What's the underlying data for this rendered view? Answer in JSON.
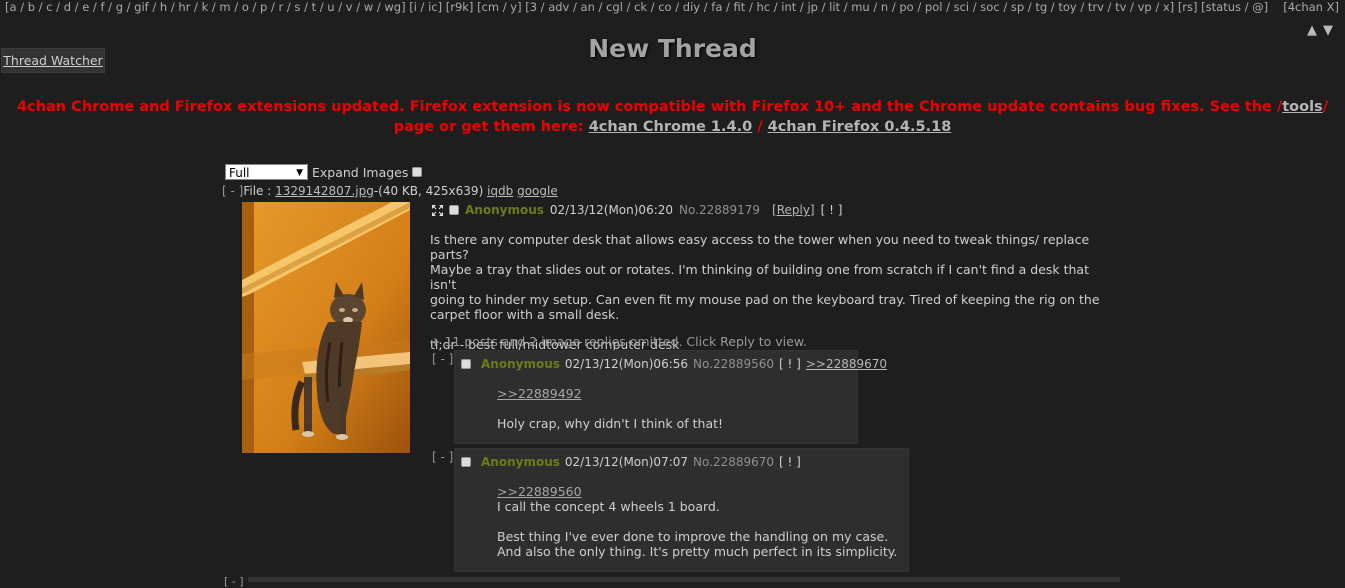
{
  "nav": {
    "boards_text": "[a / b / c / d / e / f / g / gif / h / hr / k / m / o / p / r / s / t / u / v / w / wg] [i / ic] [r9k] [cm / y] [3 / adv / an / cgl / ck / co / diy / fa / fit / hc / int / jp / lit / mu / n / po / pol / sci / soc / sp / tg / toy / trv / tv / vp / x] [rs] [status / @]",
    "extension_label": "[4chan X]",
    "arrow_up": "▲",
    "arrow_down": "▼"
  },
  "page_title": "New Thread",
  "thread_watcher_label": "Thread Watcher",
  "announcement": {
    "text_before": "4chan Chrome and Firefox extensions updated. Firefox extension is now compatible with Firefox 10+ and the Chrome update contains bug fixes. See the /",
    "tools_link": "tools",
    "text_mid": "/ page or get them here: ",
    "chrome_link": "4chan Chrome 1.4.0",
    "separator": " / ",
    "firefox_link": "4chan Firefox 0.4.5.18"
  },
  "controls": {
    "image_mode": "Full",
    "expand_images_label": "Expand Images"
  },
  "op": {
    "toggle": "[ - ]",
    "file_prefix": "File : ",
    "file_name": "1329142807.jpg",
    "file_info": "-(40 KB, 425x639) ",
    "iqdb_link": "iqdb",
    "google_link": "google",
    "name": "Anonymous",
    "date": "02/13/12(Mon)06:20",
    "post_no": "No.22889179",
    "reply_link": "[Reply]",
    "report": "[ ! ]",
    "body_lines": [
      "Is there any computer desk that allows easy access to the tower when you need to tweak things/ replace parts?",
      "Maybe a tray that slides out or rotates. I'm thinking of building one from scratch if I can't find a desk that isn't",
      "going to hinder my setup. Can even fit my mouse pad on the keyboard tray. Tired of keeping the rig on the",
      "carpet floor with a small desk.",
      "",
      "tl;dr - best full/midtower computer desk"
    ],
    "omitted": "+ 11 posts and 2 image replies omitted. Click Reply to view."
  },
  "replies": [
    {
      "toggle": "[ - ]",
      "name": "Anonymous",
      "date": "02/13/12(Mon)06:56",
      "post_no": "No.22889560",
      "report": "[ ! ]",
      "backlink": ">>22889670",
      "quote": ">>22889492",
      "lines": [
        "Holy crap, why didn't I think of that!"
      ]
    },
    {
      "toggle": "[ - ]",
      "name": "Anonymous",
      "date": "02/13/12(Mon)07:07",
      "post_no": "No.22889670",
      "report": "[ ! ]",
      "backlink": "",
      "quote": ">>22889560",
      "lines": [
        "I call the concept 4 wheels 1 board.",
        "",
        "Best thing I've ever done to improve the handling on my case.",
        "And also the only thing. It's pretty much perfect in its simplicity."
      ]
    }
  ],
  "bottom_toggle": "[ - ]",
  "colors": {
    "background": "#1e1e1e",
    "announcement": "#e00000",
    "name": "#6c7d17",
    "reply_bg": "#2e2e2e"
  }
}
